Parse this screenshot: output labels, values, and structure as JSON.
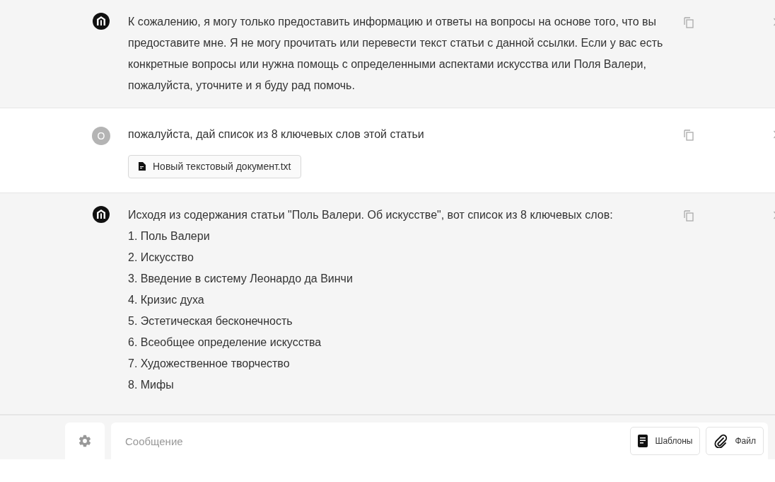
{
  "messages": [
    {
      "kind": "assistant",
      "text": "К сожалению, я могу только предоставить информацию и ответы на вопросы на основе того, что вы предоставите мне. Я не могу прочитать или перевести текст статьи с данной ссылки. Если у вас есть конкретные вопросы или нужна помощь с определенными аспектами искусства или Поля Валери, пожалуйста, уточните и я буду рад помочь."
    },
    {
      "kind": "user",
      "avatar": "O",
      "text": "пожалуйста, дай список из 8 ключевых слов этой статьи",
      "attachment": "Новый текстовый документ.txt"
    },
    {
      "kind": "assistant",
      "text": "Исходя из содержания статьи \"Поль Валери. Об искусстве\", вот список из 8 ключевых слов:",
      "list": [
        "1. Поль Валери",
        "2. Искусство",
        "3. Введение в систему Леонардо да Винчи",
        "4. Кризис духа",
        "5. Эстетическая бесконечность",
        "6. Всеобщее определение искусства",
        "7. Художественное творчество",
        "8. Мифы"
      ]
    }
  ],
  "composer": {
    "placeholder": "Сообщение",
    "buttons": [
      {
        "kind": "templates",
        "label": "Шаблоны"
      },
      {
        "kind": "file",
        "label": "Файл"
      }
    ]
  }
}
